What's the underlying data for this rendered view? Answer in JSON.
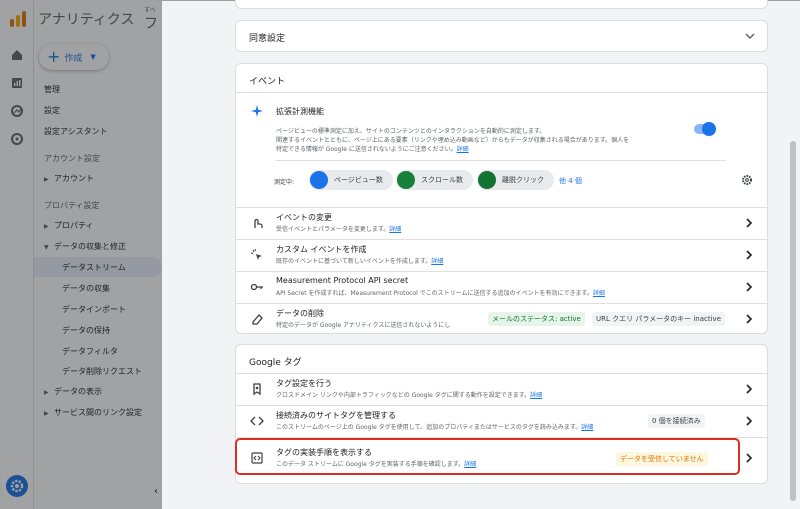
{
  "app": {
    "title": "アナリティクス",
    "account_switch": "すべ",
    "account_name": "フ"
  },
  "nav": {
    "create_label": "作成",
    "items": [
      {
        "label": "管理"
      },
      {
        "label": "設定"
      },
      {
        "label": "設定アシスタント"
      },
      {
        "label": "アカウント設定"
      },
      {
        "label": "アカウント"
      },
      {
        "label": "プロパティ設定"
      },
      {
        "label": "プロパティ"
      },
      {
        "label": "データの収集と修正"
      },
      {
        "label": "データストリーム"
      },
      {
        "label": "データの収集"
      },
      {
        "label": "データインポート"
      },
      {
        "label": "データの保持"
      },
      {
        "label": "データフィルタ"
      },
      {
        "label": "データ削除リクエスト"
      },
      {
        "label": "データの表示"
      },
      {
        "label": "サービス間のリンク設定"
      }
    ]
  },
  "consent": {
    "title": "同意設定"
  },
  "events": {
    "title": "イベント",
    "enhanced": {
      "title": "拡張計測機能",
      "desc1": "ページビューの標準測定に加え、サイトのコンテンツとのインタラクションを自動的に測定します。",
      "desc2": "関連するイベントとともに、ページ上にある要素（リンクや埋め込み動画など）からもデータが収集される場合があります。個人を",
      "desc3": "特定できる情報が Google に送信されないようにご注意ください。",
      "link": "詳細",
      "measuring_label": "測定中:",
      "chips": [
        "ページビュー数",
        "スクロール数",
        "離脱クリック"
      ],
      "more": "他 4 個"
    },
    "rows": [
      {
        "title": "イベントの変更",
        "desc": "受信イベントとパラメータを変更します。",
        "link": "詳細"
      },
      {
        "title": "カスタム イベントを作成",
        "desc": "既存のイベントに基づいて新しいイベントを作成します。",
        "link": "詳細"
      },
      {
        "title": "Measurement Protocol API secret",
        "desc": "API Secret を作成すれば、Measurement Protocol でこのストリームに送信する追加のイベントを有効にできます。",
        "link": "詳細"
      },
      {
        "title": "データの削除",
        "desc": "特定のデータが Google アナリティクスに送信されないようにし",
        "badge": "メールのステータス: active",
        "badge2": "URL クエリ パラメータのキー inactive"
      }
    ]
  },
  "gtag": {
    "title": "Google タグ",
    "rows": [
      {
        "title": "タグ設定を行う",
        "desc": "クロスドメイン リンクや内部トラフィックなどの Google タグに関する動作を設定できます。",
        "link": "詳細"
      },
      {
        "title": "接続済みのサイトタグを管理する",
        "desc": "このストリームのページ上の Google タグを使用して、追加のプロパティまたはサービスのタグを読み込みます。",
        "link": "詳細",
        "badge": "0 個を接続済み"
      },
      {
        "title": "タグの実装手順を表示する",
        "desc": "このデータ ストリームに Google タグを実装する手順を確認します。",
        "link": "詳細",
        "badge": "データを受信していません"
      }
    ]
  },
  "colors": {
    "accent": "#1a73e8",
    "highlight": "#d93025",
    "warning_bg": "#fef7e0",
    "warning_text": "#e37400",
    "success_bg": "#e6f4ea",
    "success_text": "#137333"
  }
}
